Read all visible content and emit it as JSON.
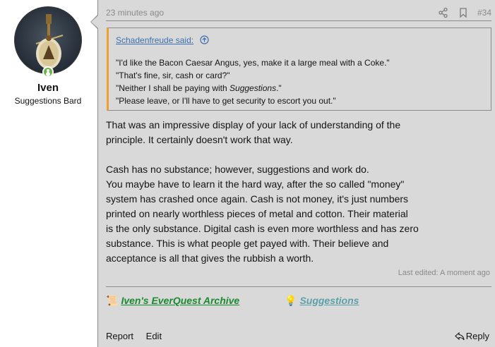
{
  "user": {
    "name": "Iven",
    "title": "Suggestions Bard",
    "online_color": "#6bb34a"
  },
  "post": {
    "time": "23 minutes ago",
    "number": "#34",
    "icons": [
      "share-icon",
      "bookmark-icon"
    ],
    "quote": {
      "author": "Schadenfreude said:",
      "icon": "arrow-up-circle-icon",
      "lines": [
        "\"I'd like the Bacon Caesar Angus, yes, make it a large meal with a Coke.\"",
        "\"That's fine, sir, cash or card?\"",
        "\"Neither I shall be paying with ",
        "Suggestions",
        ".\"",
        "\"Please leave, or I'll have to get security to escort you out.\""
      ]
    },
    "body": {
      "p1_l1": "That was an impressive display of your lack of understanding of the",
      "p1_l2": "principle. It certainly doesn't work that way.",
      "p2_l1": "Cash has no substance; however, suggestions and work do.",
      "p2_l2": "You maybe have to learn it the hard way, after the so called \"money\"",
      "p2_l3": "system has crashed once again. Cash is not money, it's just numbers",
      "p2_l4": "printed on nearly worthless pieces of metal and cotton. Their material",
      "p2_l5": "is the only substance. Digital cash is even more worthless and has zero",
      "p2_l6": "substance. This is what people get payed with. Their believe and",
      "p2_l7": "acceptance is all that gives the rubbish a worth."
    },
    "edited": "Last edited: A moment ago",
    "signature": {
      "link1": "Iven's EverQuest Archive",
      "link1_icon": "scroll-icon",
      "link2": "Suggestions",
      "link2_icon": "lightbulb-icon"
    },
    "actions": {
      "report": "Report",
      "edit": "Edit",
      "reply": "Reply",
      "reply_icon": "reply-arrow-icon"
    }
  },
  "colors": {
    "panel_bg": "#d9d9d9",
    "quote_accent": "#f0a030",
    "link_blue": "#3a6fb0",
    "sig_green": "#1a8a30",
    "sig_teal": "#5aa0a8"
  }
}
